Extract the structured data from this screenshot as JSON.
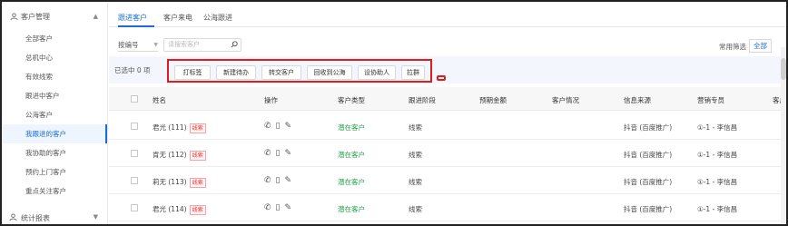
{
  "sidebar": {
    "group_title": "客户管理",
    "group_icon": "user-group-icon",
    "items": [
      {
        "label": "全部客户"
      },
      {
        "label": "总机中心"
      },
      {
        "label": "有效线索"
      },
      {
        "label": "跟进中客户"
      },
      {
        "label": "公海客户"
      },
      {
        "label": "我跟进的客户"
      },
      {
        "label": "我协助的客户"
      },
      {
        "label": "预约上门客户"
      },
      {
        "label": "重点关注客户"
      }
    ],
    "active_index": 5,
    "bottom_group": "统计报表"
  },
  "tabs": [
    {
      "label": "跟进客户"
    },
    {
      "label": "客户来电"
    },
    {
      "label": "公海跟进"
    }
  ],
  "filters": {
    "select_value": "按编号",
    "search_placeholder": "请搜索客户",
    "common_filter_label": "常用筛选",
    "all_label": "全部"
  },
  "selection": {
    "count_text": "已选中 0 项",
    "actions": [
      {
        "label": "打标签"
      },
      {
        "label": "新建待办"
      },
      {
        "label": "转交客户"
      },
      {
        "label": "回收到公海"
      },
      {
        "label": "设协助人"
      },
      {
        "label": "拉群"
      }
    ]
  },
  "table": {
    "columns": [
      "姓名",
      "操作",
      "客户类型",
      "跟进阶段",
      "预期金额",
      "客户情况",
      "信息来源",
      "营销专员",
      "客户"
    ],
    "rows": [
      {
        "name": "君光 (111)",
        "tag": "线索",
        "type": "潜在客户",
        "stage": "线索",
        "amount": "",
        "situation": "",
        "source": "抖音 (百度推广)",
        "agent": "①-1 - 李信昌"
      },
      {
        "name": "肯无 (112)",
        "tag": "线索",
        "type": "潜在客户",
        "stage": "线索",
        "amount": "",
        "situation": "",
        "source": "抖音 (百度推广)",
        "agent": "①-1 - 李信昌"
      },
      {
        "name": "莉无 (113)",
        "tag": "线索",
        "type": "潜在客户",
        "stage": "线索",
        "amount": "",
        "situation": "",
        "source": "抖音 (百度推广)",
        "agent": "①-1 - 李信昌"
      },
      {
        "name": "君光 (114)",
        "tag": "线索",
        "type": "潜在客户",
        "stage": "线索",
        "amount": "",
        "situation": "",
        "source": "抖音 (百度推广)",
        "agent": "①-1 - 李信昌"
      }
    ]
  },
  "colors": {
    "accent": "#1a6fd4",
    "highlight_red": "#e01c1c",
    "tag_red": "#e33333",
    "type_green": "#22a34a"
  }
}
